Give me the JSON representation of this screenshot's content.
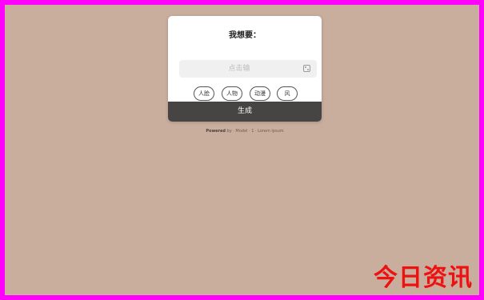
{
  "card": {
    "title": "我想要：",
    "input_placeholder": "点击输",
    "chips": [
      "人脸",
      "人物",
      "动漫",
      "风"
    ],
    "submit_label": "生成"
  },
  "footer": {
    "prefix": "Powered",
    "rest": "by · Model · 1 · Lorem ipsum"
  },
  "watermark": "今日资讯",
  "colors": {
    "background": "#c9ae9e",
    "frame": "#ff00ff",
    "submit": "#474543",
    "watermark": "#ee1111"
  }
}
